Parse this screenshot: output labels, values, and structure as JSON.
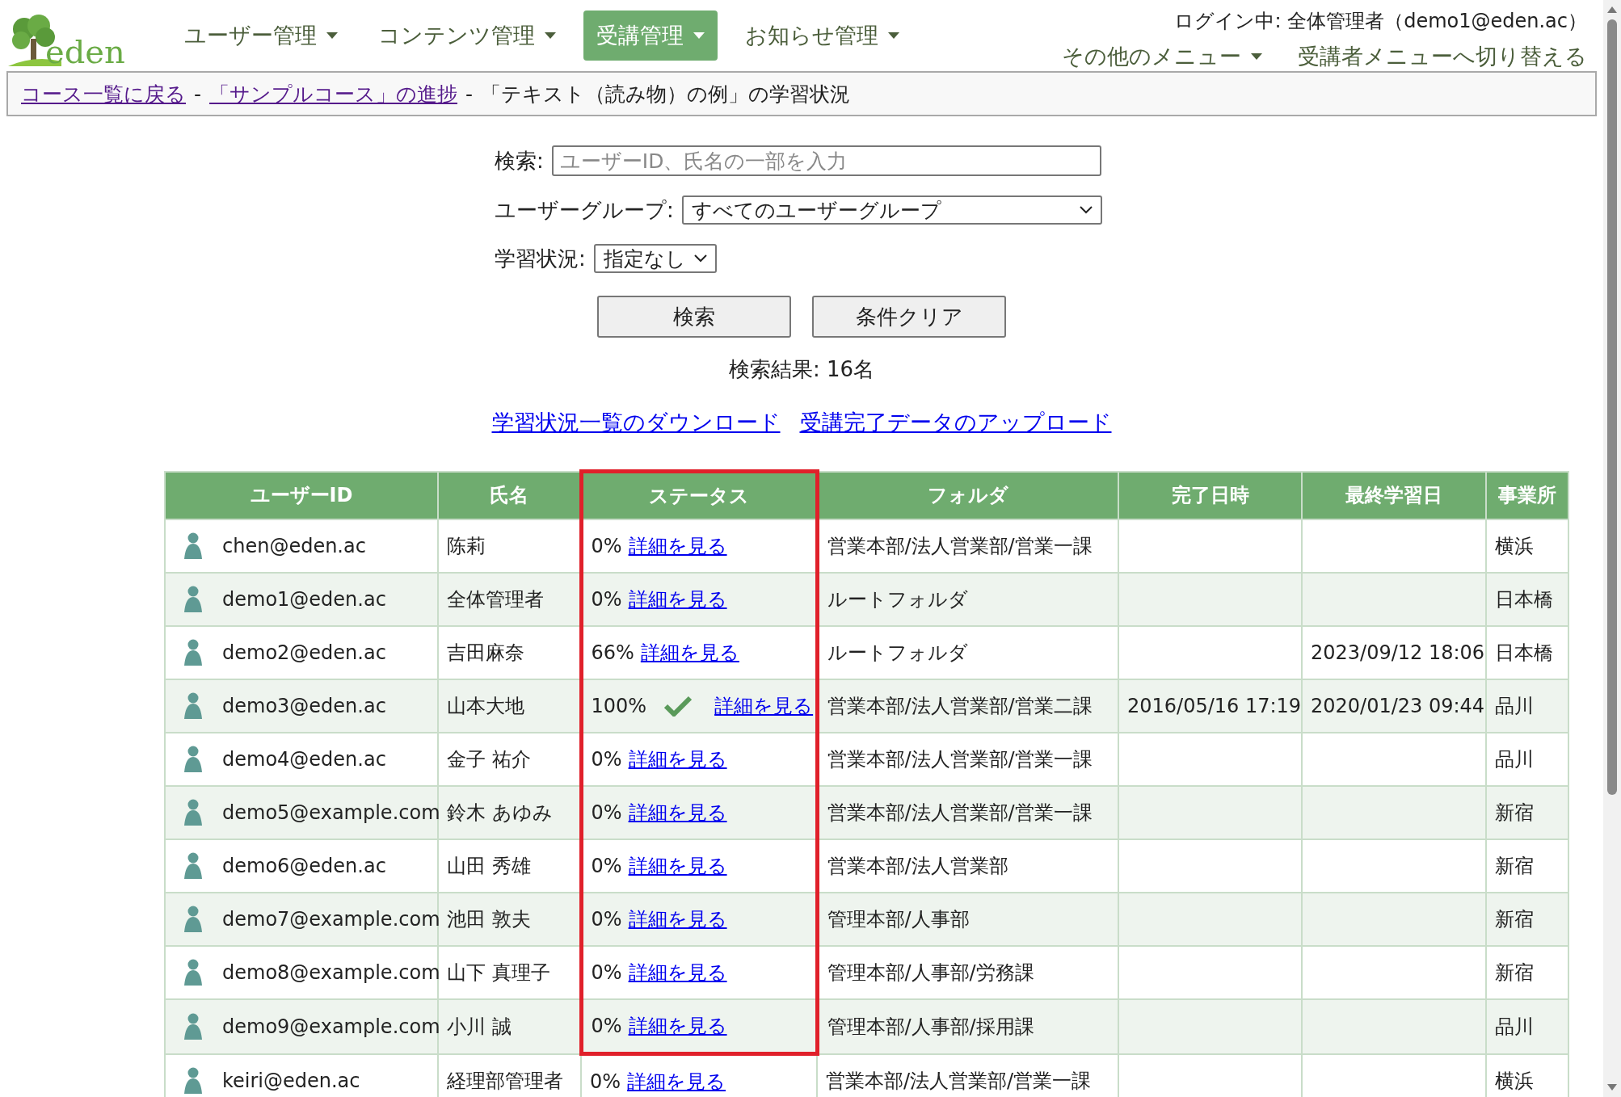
{
  "logo": {
    "text": "eden"
  },
  "nav": [
    {
      "label": "ユーザー管理",
      "selected": false
    },
    {
      "label": "コンテンツ管理",
      "selected": false
    },
    {
      "label": "受講管理",
      "selected": true
    },
    {
      "label": "お知らせ管理",
      "selected": false
    }
  ],
  "account": {
    "login": "ログイン中: 全体管理者（demo1@eden.ac）",
    "menus": [
      {
        "label": "その他のメニュー",
        "dropdown": true
      },
      {
        "label": "受講者メニューへ切り替える",
        "dropdown": false
      }
    ]
  },
  "breadcrumb": [
    {
      "label": "コース一覧に戻る",
      "link": true
    },
    {
      "label": "-",
      "link": false
    },
    {
      "label": "「サンプルコース」の進捗",
      "link": true
    },
    {
      "label": "-",
      "link": false
    },
    {
      "label": "「テキスト（読み物）の例」の学習状況",
      "link": false
    }
  ],
  "search": {
    "label": "検索:",
    "placeholder": "ユーザーID、氏名の一部を入力"
  },
  "group_filter": {
    "label": "ユーザーグループ:",
    "value": "すべてのユーザーグループ"
  },
  "status_filter": {
    "label": "学習状況:",
    "value": "指定なし"
  },
  "buttons": [
    "検索",
    "条件クリア"
  ],
  "result": "検索結果: 16名",
  "links": [
    "学習状況一覧のダウンロード",
    "受講完了データのアップロード"
  ],
  "table": {
    "columns": [
      {
        "label": "ユーザーID",
        "highlighted": false
      },
      {
        "label": "氏名",
        "highlighted": false
      },
      {
        "label": "ステータス",
        "highlighted": true
      },
      {
        "label": "フォルダ",
        "highlighted": false
      },
      {
        "label": "完了日時",
        "highlighted": false
      },
      {
        "label": "最終学習日",
        "highlighted": false
      },
      {
        "label": "事業所",
        "highlighted": false
      }
    ],
    "rows": [
      {
        "user_id": "chen@eden.ac",
        "name": "陈莉",
        "progress": "0%",
        "completed": false,
        "detail": "詳細を見る",
        "folder": "営業本部/法人営業部/営業一課",
        "completed_at": "",
        "last_study": "",
        "office": "横浜",
        "highlighted": true
      },
      {
        "user_id": "demo1@eden.ac",
        "name": "全体管理者",
        "progress": "0%",
        "completed": false,
        "detail": "詳細を見る",
        "folder": "ルートフォルダ",
        "completed_at": "",
        "last_study": "",
        "office": "日本橋",
        "highlighted": true
      },
      {
        "user_id": "demo2@eden.ac",
        "name": "吉田麻奈",
        "progress": "66%",
        "completed": false,
        "detail": "詳細を見る",
        "folder": "ルートフォルダ",
        "completed_at": "",
        "last_study": "2023/09/12 18:06",
        "office": "日本橋",
        "highlighted": true
      },
      {
        "user_id": "demo3@eden.ac",
        "name": "山本大地",
        "progress": "100%",
        "completed": true,
        "detail": "詳細を見る",
        "folder": "営業本部/法人営業部/営業二課",
        "completed_at": "2016/05/16 17:19",
        "last_study": "2020/01/23 09:44",
        "office": "品川",
        "highlighted": true
      },
      {
        "user_id": "demo4@eden.ac",
        "name": "金子 祐介",
        "progress": "0%",
        "completed": false,
        "detail": "詳細を見る",
        "folder": "営業本部/法人営業部/営業一課",
        "completed_at": "",
        "last_study": "",
        "office": "品川",
        "highlighted": true
      },
      {
        "user_id": "demo5@example.com",
        "name": "鈴木 あゆみ",
        "progress": "0%",
        "completed": false,
        "detail": "詳細を見る",
        "folder": "営業本部/法人営業部/営業一課",
        "completed_at": "",
        "last_study": "",
        "office": "新宿",
        "highlighted": true
      },
      {
        "user_id": "demo6@eden.ac",
        "name": "山田 秀雄",
        "progress": "0%",
        "completed": false,
        "detail": "詳細を見る",
        "folder": "営業本部/法人営業部",
        "completed_at": "",
        "last_study": "",
        "office": "新宿",
        "highlighted": true
      },
      {
        "user_id": "demo7@example.com",
        "name": "池田 敦夫",
        "progress": "0%",
        "completed": false,
        "detail": "詳細を見る",
        "folder": "管理本部/人事部",
        "completed_at": "",
        "last_study": "",
        "office": "新宿",
        "highlighted": true
      },
      {
        "user_id": "demo8@example.com",
        "name": "山下 真理子",
        "progress": "0%",
        "completed": false,
        "detail": "詳細を見る",
        "folder": "管理本部/人事部/労務課",
        "completed_at": "",
        "last_study": "",
        "office": "新宿",
        "highlighted": true
      },
      {
        "user_id": "demo9@example.com",
        "name": "小川 誠",
        "progress": "0%",
        "completed": false,
        "detail": "詳細を見る",
        "folder": "管理本部/人事部/採用課",
        "completed_at": "",
        "last_study": "",
        "office": "品川",
        "highlighted": true
      },
      {
        "user_id": "keiri@eden.ac",
        "name": "経理部管理者",
        "progress": "0%",
        "completed": false,
        "detail": "詳細を見る",
        "folder": "営業本部/法人営業部/営業一課",
        "completed_at": "",
        "last_study": "",
        "office": "横浜",
        "highlighted": false
      }
    ]
  }
}
